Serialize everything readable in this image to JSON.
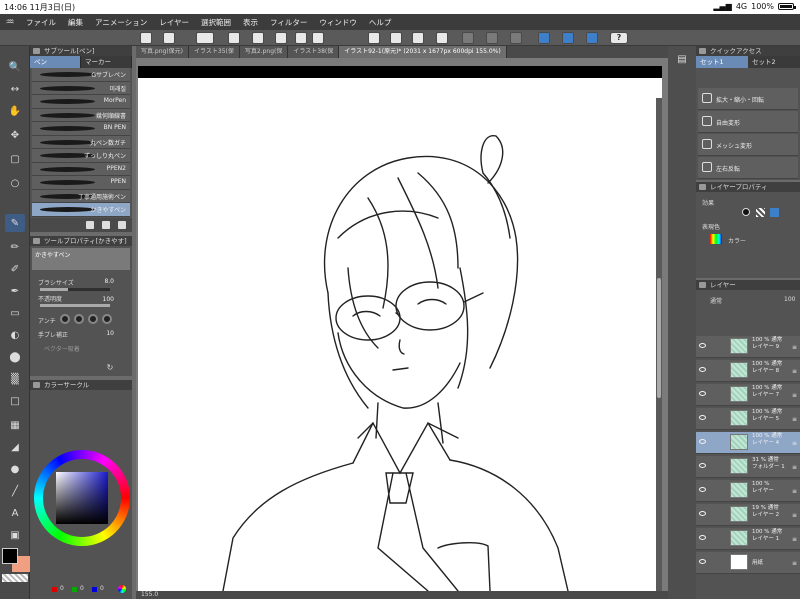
{
  "status_bar": {
    "time": "14:06",
    "date": "11月3日(日)",
    "signal": "4G",
    "battery": "100%"
  },
  "menu": [
    "ファイル",
    "編集",
    "アニメーション",
    "レイヤー",
    "選択範囲",
    "表示",
    "フィルター",
    "ウィンドウ",
    "ヘルプ"
  ],
  "subtool": {
    "title": "サブツール[ペン]",
    "tabs": [
      "ペン",
      "マーカー"
    ],
    "brushes": [
      "Gサブレペン",
      "미래질",
      "MorPen",
      "幾何順線書",
      "BN PEN",
      "丸ペン数ガチ",
      "ずっしり丸ペン",
      "PPEN2",
      "PPEN",
      "丁寧通用施術ペン",
      "かきやすペン"
    ]
  },
  "tool_property": {
    "title": "ツールプロパティ[かきやす]",
    "brush_name": "かきやすペン",
    "brush_size_label": "ブラシサイズ",
    "brush_size_value": "8.0",
    "opacity_label": "不透明度",
    "opacity_value": "100",
    "opacity_fraction": 1.0,
    "antialias_label": "アンチ",
    "stabilization_label": "手ブレ補正",
    "stabilization_value": "10",
    "vector_label": "ベクター吸着"
  },
  "color_panel": {
    "title": "カラーサークル",
    "values": [
      "0",
      "0",
      "0"
    ]
  },
  "canvas": {
    "tabs": [
      "写真.png(保元)",
      "イラスト35(保",
      "写真2.png(保",
      "イラスト38(保",
      "イラスト92-1(原元)* (2031 x 1677px 600dpi 155.0%)"
    ],
    "zoom": "155.0"
  },
  "quick_access": {
    "title": "クイックアクセス",
    "tabs": [
      "セット1",
      "セット2"
    ],
    "items": [
      "拡大・縮小・回転",
      "自由変形",
      "メッシュ変形",
      "左右反転"
    ]
  },
  "layer_property": {
    "title": "レイヤープロパティ",
    "effect_label": "効果",
    "display_color_label": "表現色",
    "display_color_value": "カラー"
  },
  "layer_panel": {
    "title": "レイヤー",
    "blend_mode": "通常",
    "opacity": "100",
    "layers": [
      {
        "pct": "100 %",
        "mode": "通常",
        "name": "レイヤー 9",
        "sel": false
      },
      {
        "pct": "100 %",
        "mode": "通常",
        "name": "レイヤー 8",
        "sel": false
      },
      {
        "pct": "100 %",
        "mode": "通常",
        "name": "レイヤー 7",
        "sel": false
      },
      {
        "pct": "100 %",
        "mode": "通常",
        "name": "レイヤー 5",
        "sel": false
      },
      {
        "pct": "100 %",
        "mode": "通常",
        "name": "レイヤー 4",
        "sel": true
      },
      {
        "pct": "31 %",
        "mode": "通常",
        "name": "フォルダー 1",
        "sel": false
      },
      {
        "pct": "100 %",
        "mode": "",
        "name": "レイヤー",
        "sel": false
      },
      {
        "pct": "19 %",
        "mode": "通常",
        "name": "レイヤー 2",
        "sel": false
      },
      {
        "pct": "100 %",
        "mode": "通常",
        "name": "レイヤー 1",
        "sel": false
      },
      {
        "pct": "",
        "mode": "",
        "name": "用紙",
        "sel": false
      }
    ]
  }
}
